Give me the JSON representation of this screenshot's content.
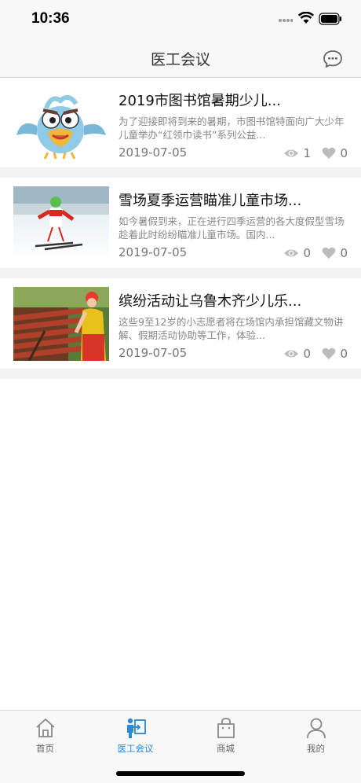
{
  "status_bar": {
    "time": "10:36"
  },
  "nav": {
    "title": "医工会议"
  },
  "articles": [
    {
      "title": "2019市图书馆暑期少儿...",
      "description": "为了迎接即将到来的暑期，市图书馆特面向广大少年儿童举办“红领巾读书”系列公益...",
      "date": "2019-07-05",
      "views": "1",
      "likes": "0",
      "image": "cartoon-bird-mascot"
    },
    {
      "title": "雪场夏季运营瞄准儿童市场...",
      "description": "如今暑假到来，正在进行四季运营的各大度假型雪场趁着此时纷纷瞄准儿童市场。国内...",
      "date": "2019-07-05",
      "views": "0",
      "likes": "0",
      "image": "child-skiing"
    },
    {
      "title": "缤纷活动让乌鲁木齐少儿乐...",
      "description": "这些9至12岁的小志愿者将在场馆内承担馆藏文物讲解、假期活动协助等工作，体验...",
      "date": "2019-07-05",
      "views": "0",
      "likes": "0",
      "image": "volunteer-wiping-bench"
    }
  ],
  "tabs": [
    {
      "label": "首页",
      "icon": "home-icon",
      "active": false
    },
    {
      "label": "医工会议",
      "icon": "meeting-icon",
      "active": true
    },
    {
      "label": "商城",
      "icon": "shopping-bag-icon",
      "active": false
    },
    {
      "label": "我的",
      "icon": "person-icon",
      "active": false
    }
  ],
  "colors": {
    "accent": "#2a8ad4",
    "text": "#111111",
    "muted": "#888888"
  }
}
